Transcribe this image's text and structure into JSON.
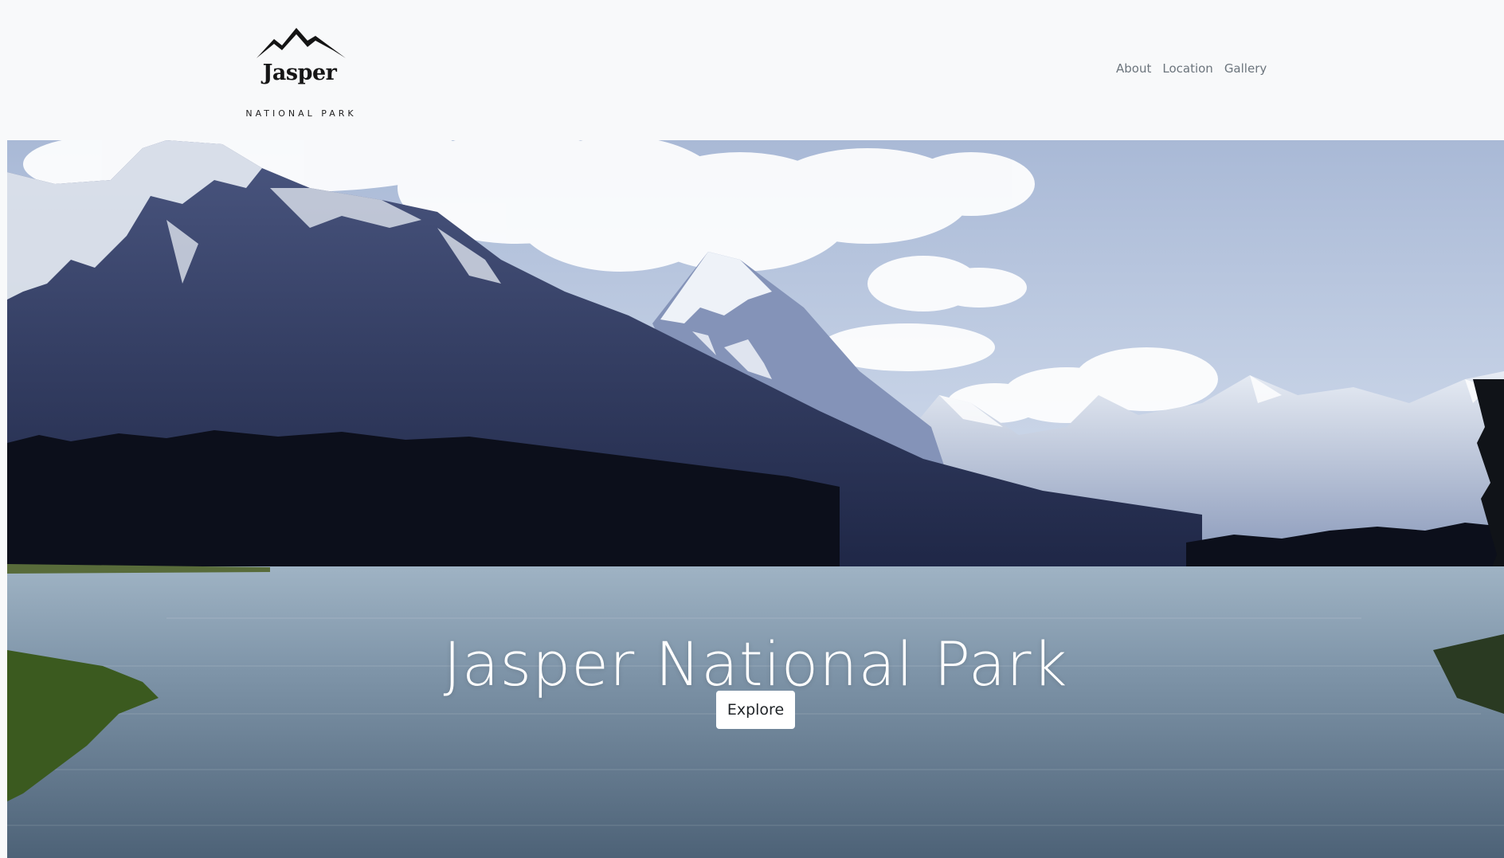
{
  "brand": {
    "name": "Jasper",
    "subtitle": "NATIONAL PARK"
  },
  "nav": {
    "links": [
      "About",
      "Location",
      "Gallery"
    ]
  },
  "hero": {
    "title": "Jasper National Park",
    "button_label": "Explore"
  },
  "colors": {
    "navbar_bg": "#f8f9fa",
    "nav_link": "#6c757d",
    "hero_text": "#ffffff",
    "button_bg": "#ffffff"
  }
}
